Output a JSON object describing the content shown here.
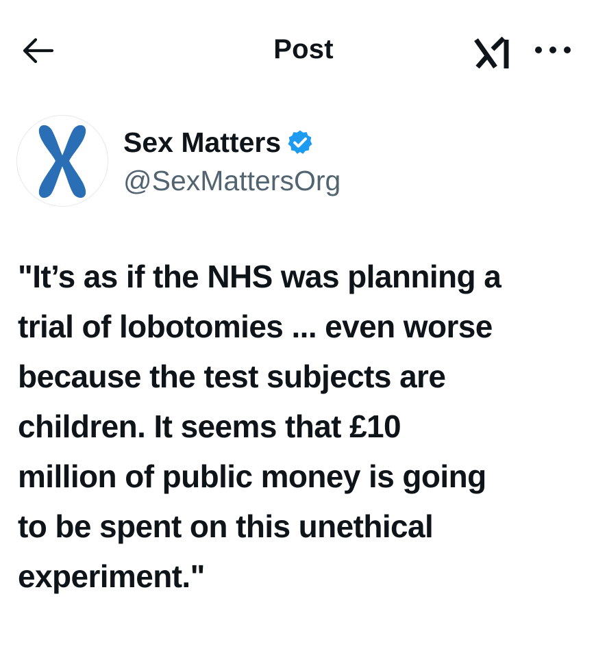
{
  "header": {
    "title": "Post",
    "back_icon": "arrow-left-icon",
    "grok_icon": "grok-icon",
    "more_icon": "more-horizontal-icon"
  },
  "author": {
    "display_name": "Sex Matters",
    "handle": "@SexMattersOrg",
    "verified": true,
    "verified_icon": "verified-badge-icon",
    "avatar_icon": "chromosome-x-logo"
  },
  "post": {
    "text": "\"It’s as if the NHS was planning a\ntrial of lobotomies ... even worse\nbecause the test subjects are\nchildren. It seems that £10\nmillion of public money is going\nto be spent on this unethical\nexperiment.\""
  },
  "colors": {
    "text_primary": "#0f1419",
    "text_secondary": "#536471",
    "verified_blue": "#1d9bf0",
    "logo_blue": "#2a6fb5"
  }
}
